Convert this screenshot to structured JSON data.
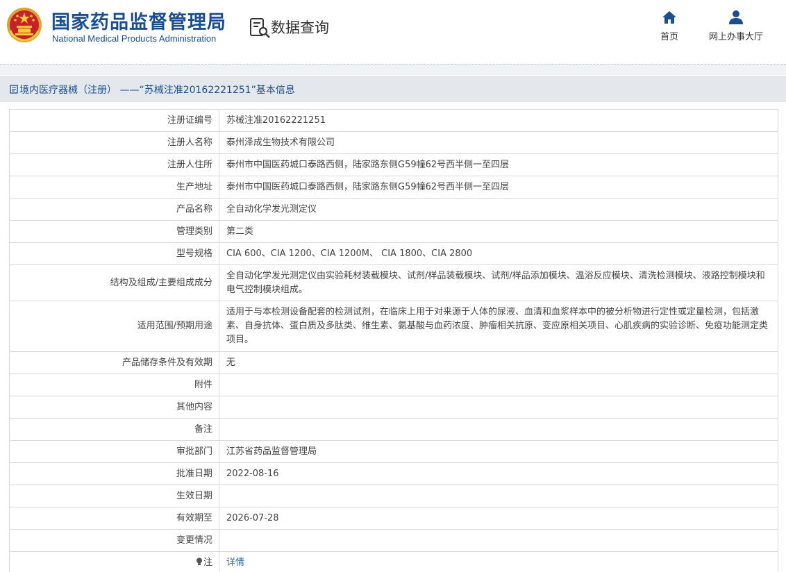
{
  "header": {
    "brand_cn": "国家药品监督管理局",
    "brand_en": "National Medical Products Administration",
    "query_title": "数据查询",
    "nav": {
      "home_label": "首页",
      "hall_label": "网上办事大厅"
    }
  },
  "breadcrumb": {
    "text": "境内医疗器械（注册） ——“苏械注准20162221251”基本信息"
  },
  "rows": [
    {
      "label": "注册证编号",
      "value": "苏械注准20162221251"
    },
    {
      "label": "注册人名称",
      "value": "泰州泽成生物技术有限公司"
    },
    {
      "label": "注册人住所",
      "value": "泰州市中国医药城口泰路西侧，陆家路东侧G59幢62号西半侧一至四层"
    },
    {
      "label": "生产地址",
      "value": "泰州市中国医药城口泰路西侧，陆家路东侧G59幢62号西半侧一至四层"
    },
    {
      "label": "产品名称",
      "value": "全自动化学发光测定仪"
    },
    {
      "label": "管理类别",
      "value": "第二类"
    },
    {
      "label": "型号规格",
      "value": "CIA 600、CIA 1200、CIA 1200M、 CIA 1800、CIA 2800"
    },
    {
      "label": "结构及组成/主要组成成分",
      "value": "全自动化学发光测定仪由实验耗材装载模块、试剂/样品装载模块、试剂/样品添加模块、温浴反应模块、清洗检测模块、液路控制模块和电气控制模块组成。"
    },
    {
      "label": "适用范围/预期用途",
      "value": "适用于与本检测设备配套的检测试剂，在临床上用于对来源于人体的尿液、血清和血浆样本中的被分析物进行定性或定量检测，包括激素、自身抗体、蛋白质及多肽类、维生素、氨基酸与血药浓度、肿瘤相关抗原、变应原相关项目、心肌疾病的实验诊断、免疫功能测定类项目。"
    },
    {
      "label": "产品储存条件及有效期",
      "value": "无"
    },
    {
      "label": "附件",
      "value": ""
    },
    {
      "label": "其他内容",
      "value": ""
    },
    {
      "label": "备注",
      "value": ""
    },
    {
      "label": "审批部门",
      "value": "江苏省药品监督管理局"
    },
    {
      "label": "批准日期",
      "value": "2022-08-16"
    },
    {
      "label": "生效日期",
      "value": ""
    },
    {
      "label": "有效期至",
      "value": "2026-07-28"
    },
    {
      "label": "变更情况",
      "value": ""
    }
  ],
  "note_row": {
    "label": "注",
    "link_text": "详情"
  },
  "colors": {
    "brand_blue": "#1a4e8f",
    "link_blue": "#2d6ab3",
    "breadcrumb_bg": "#e4e7eb",
    "border": "#d9d9d9"
  },
  "icons": {
    "emblem": "national-emblem-icon",
    "query": "document-search-icon",
    "home": "home-icon",
    "hall": "user-icon",
    "breadcrumb": "document-icon",
    "note": "lightbulb-icon"
  }
}
